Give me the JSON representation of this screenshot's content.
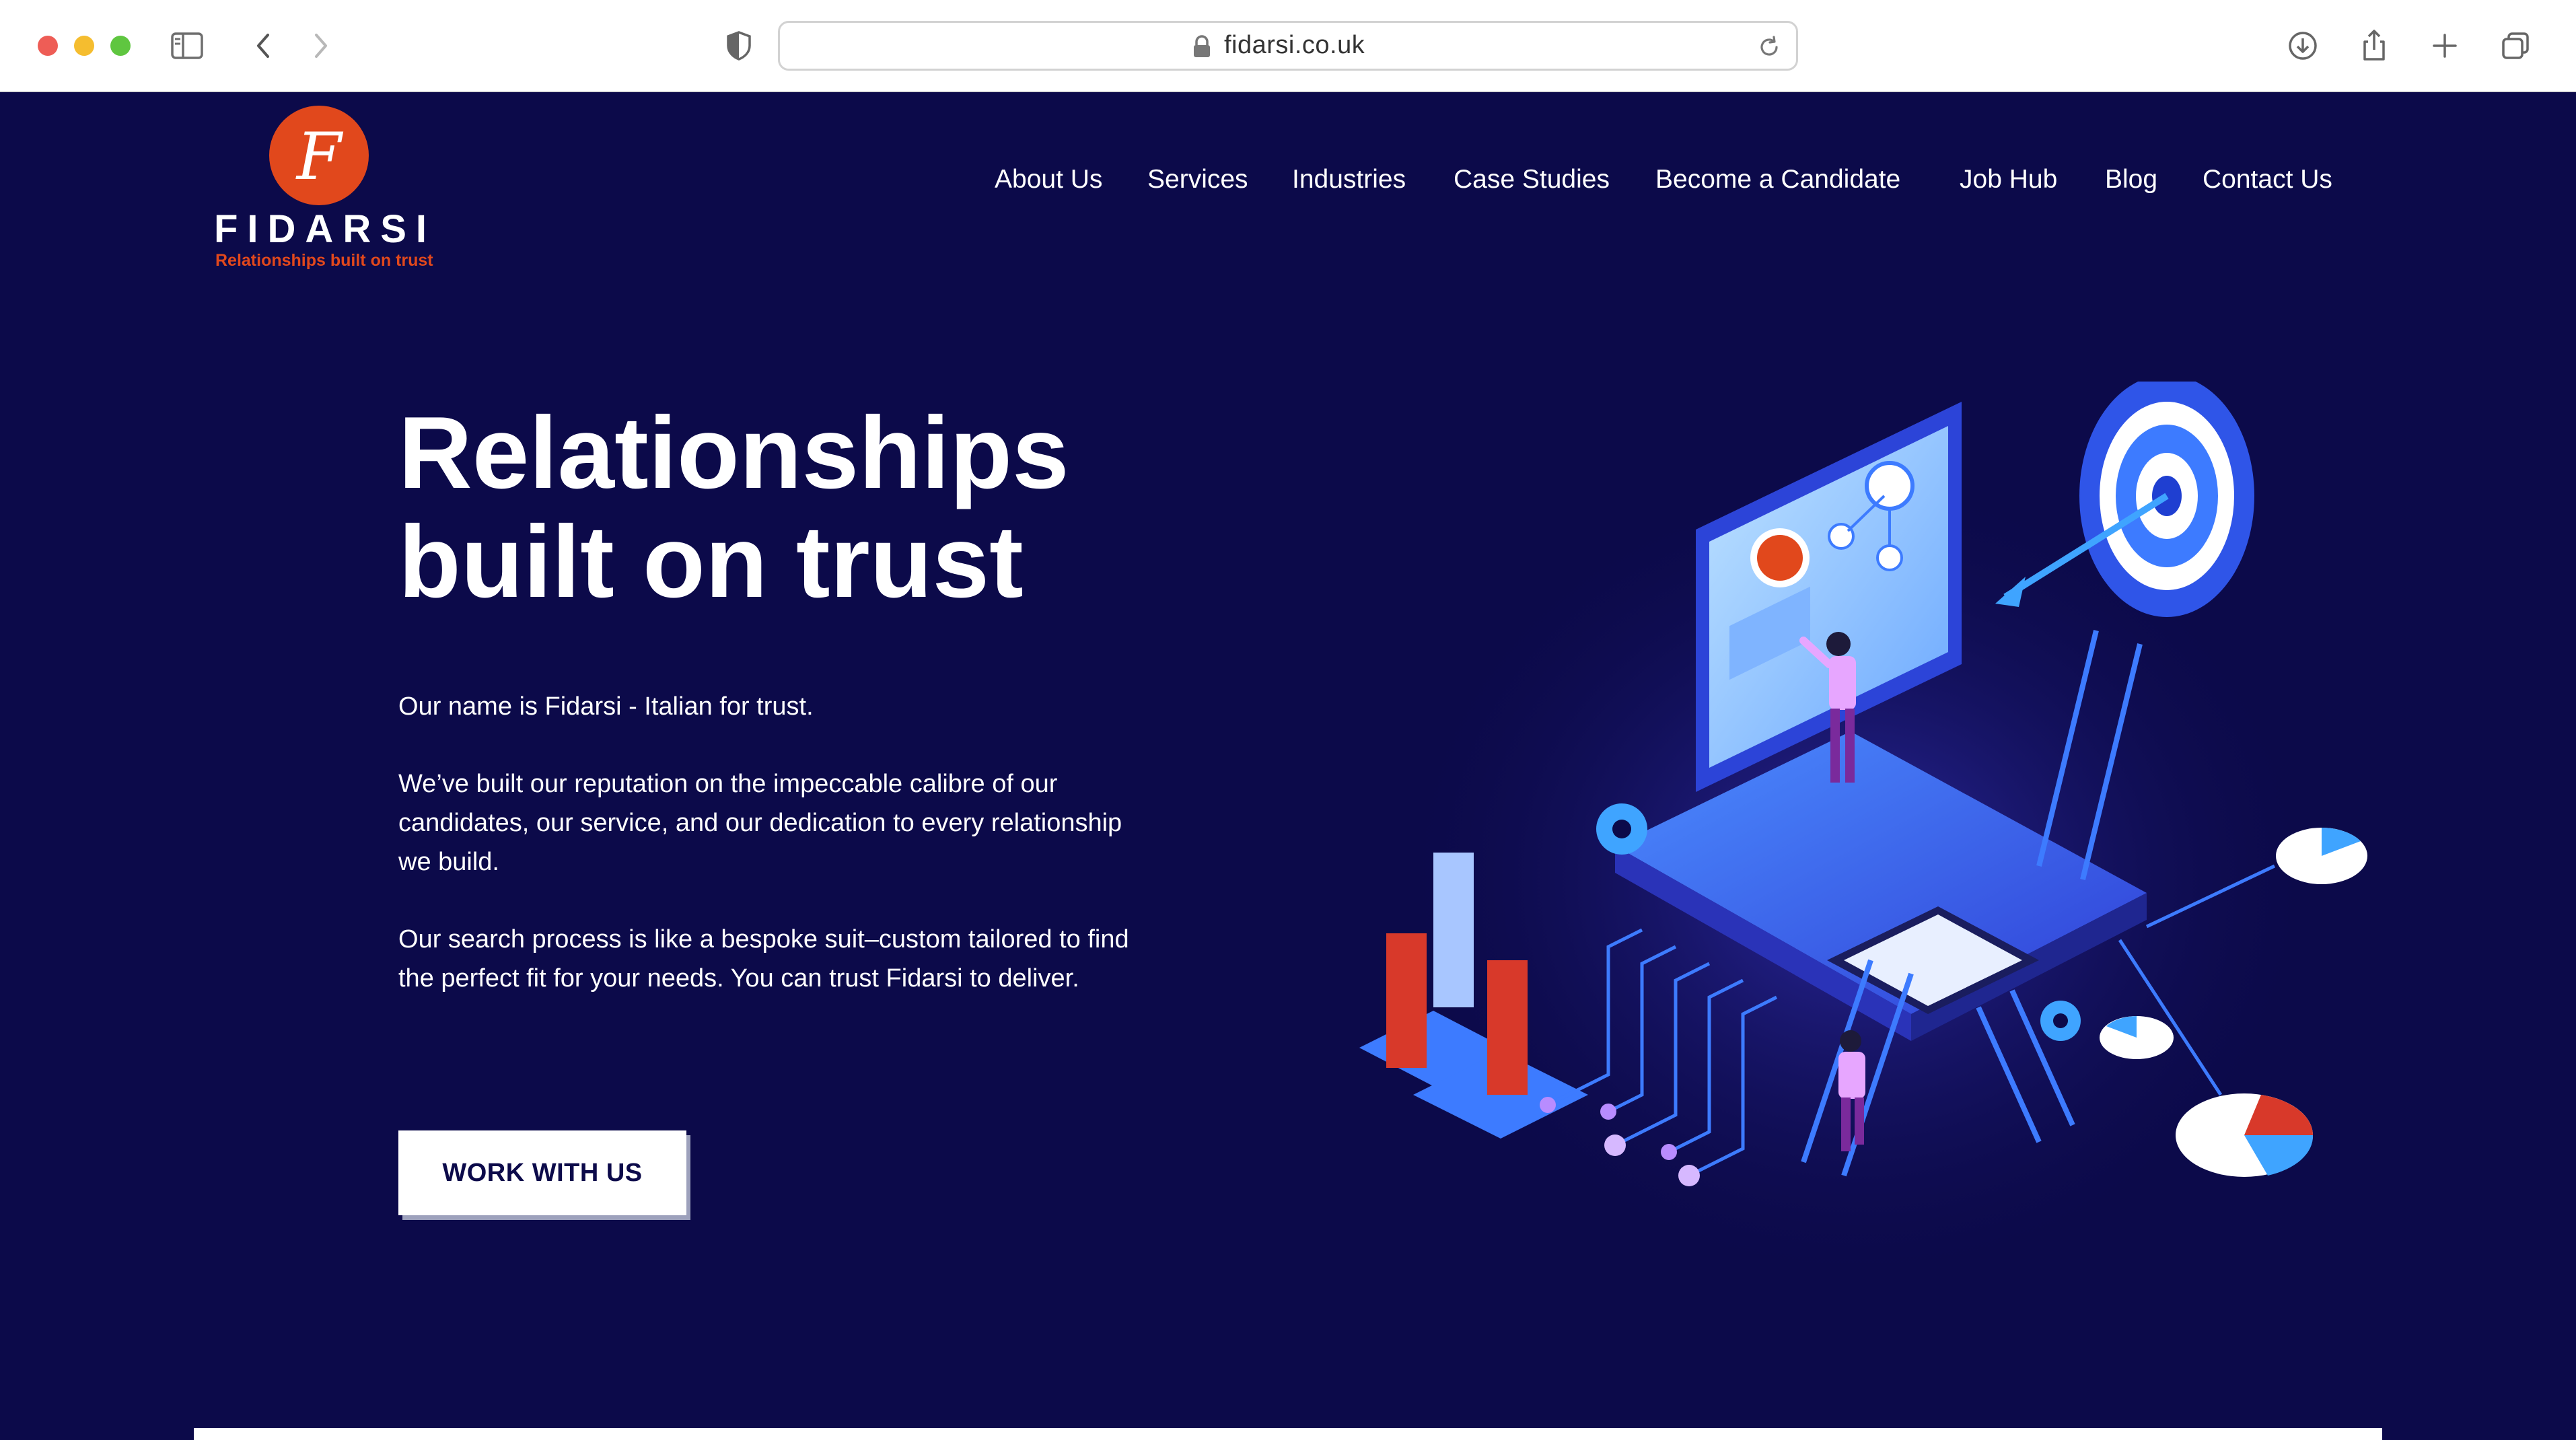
{
  "browser": {
    "url": "fidarsi.co.uk",
    "icons": [
      "sidebar-icon",
      "back-icon",
      "forward-icon",
      "shield-icon",
      "lock-icon",
      "reload-icon",
      "download-icon",
      "share-icon",
      "new-tab-icon",
      "tabs-overview-icon"
    ]
  },
  "logo": {
    "monogram": "F",
    "wordmark": "FIDARSI",
    "tagline": "Relationships built on trust"
  },
  "nav": {
    "items": [
      "About Us",
      "Services",
      "Industries",
      "Case Studies",
      "Become a Candidate",
      "Job Hub",
      "Blog",
      "Contact Us"
    ]
  },
  "hero": {
    "title_line1": "Relationships",
    "title_line2": "built on trust",
    "para1": "Our name is Fidarsi - Italian for trust.",
    "para2": "We’ve built our reputation on the impeccable calibre of our candidates, our service, and our dedication to every relationship we build.",
    "para3": "Our search process is like a bespoke suit–custom tailored to find the perfect fit for your needs. You can trust Fidarsi to deliver.",
    "cta_label": "WORK WITH US"
  },
  "colors": {
    "background": "#0c0a4a",
    "brand_orange": "#e1481c",
    "white": "#ffffff",
    "illustration_blue": "#3d7bff"
  }
}
